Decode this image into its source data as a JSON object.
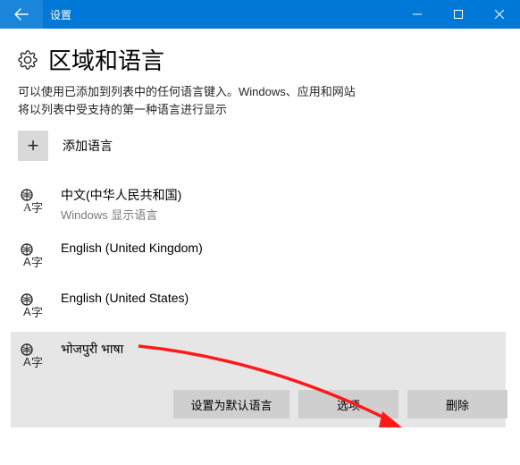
{
  "titlebar": {
    "title": "设置"
  },
  "page": {
    "title": "区域和语言",
    "desc_line1": "可以使用已添加到列表中的任何语言键入。Windows、应用和网站",
    "desc_line2": "将以列表中受支持的第一种语言进行显示"
  },
  "add_lang": {
    "label": "添加语言",
    "plus": "+"
  },
  "languages": [
    {
      "name": "中文(中华人民共和国)",
      "sub": "Windows 显示语言"
    },
    {
      "name": "English (United Kingdom)",
      "sub": ""
    },
    {
      "name": "English (United States)",
      "sub": ""
    },
    {
      "name": "भोजपुरी भाषा",
      "sub": ""
    }
  ],
  "actions": {
    "set_default": "设置为默认语言",
    "options": "选项",
    "remove": "删除"
  }
}
